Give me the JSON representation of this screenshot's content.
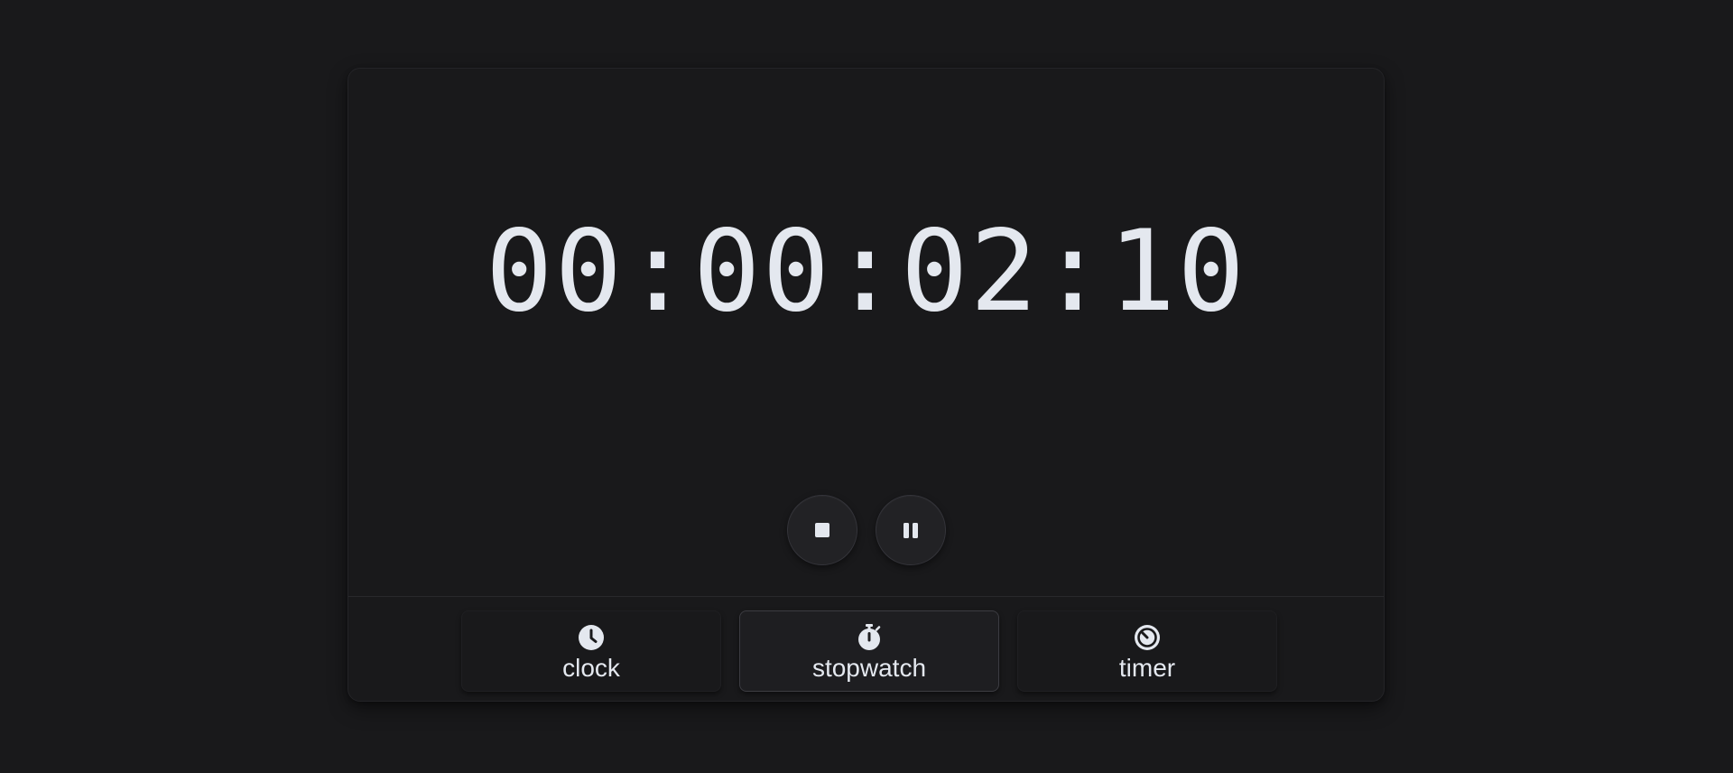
{
  "display": {
    "time": "00:00:02:10"
  },
  "controls": {
    "stop_icon": "stop-icon",
    "pause_icon": "pause-icon"
  },
  "tabs": [
    {
      "label": "clock",
      "icon": "clock-icon",
      "active": false
    },
    {
      "label": "stopwatch",
      "icon": "stopwatch-icon",
      "active": true
    },
    {
      "label": "timer",
      "icon": "timer-icon",
      "active": false
    }
  ],
  "colors": {
    "background": "#19191b",
    "text": "#e4e8ef",
    "button": "#222225"
  }
}
